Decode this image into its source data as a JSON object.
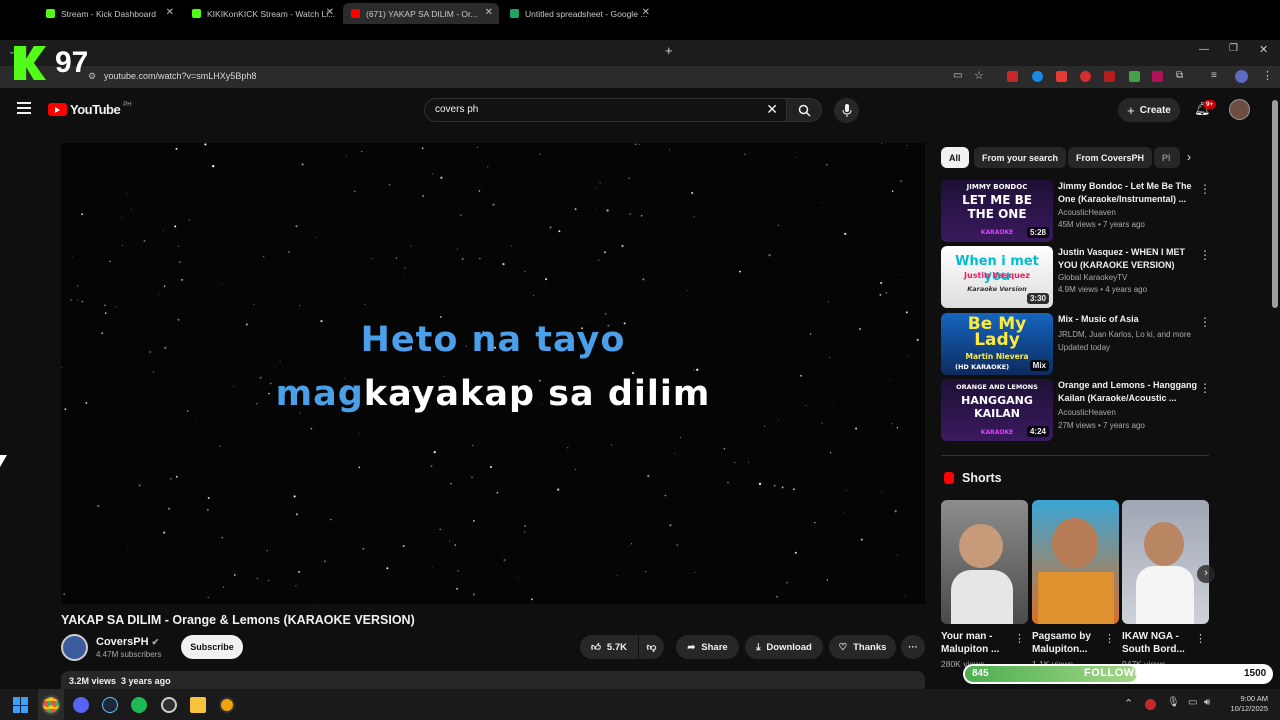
{
  "overlay": {
    "kick_counter": "97"
  },
  "browser": {
    "tabs": [
      {
        "label": "Stream - Kick Dashboard",
        "color": "#53fc18"
      },
      {
        "label": "KIKIKonKICK Stream - Watch Li...",
        "color": "#53fc18"
      },
      {
        "label": "(671) YAKAP SA DILIM - Or...",
        "color": "#ff0000"
      },
      {
        "label": "Untitled spreadsheet - Google ...",
        "color": "#1fa463"
      }
    ],
    "url": "youtube.com/watch?v=smLHXy5Bph8"
  },
  "youtube": {
    "logo_text": "YouTube",
    "region": "PH",
    "search_value": "covers ph",
    "create_label": "Create",
    "notif_count": "9+"
  },
  "video": {
    "lyric_line1": "Heto na tayo",
    "lyric_line2_sung": "mag",
    "lyric_line2_rest": "kayakap sa dilim",
    "title": "YAKAP SA DILIM - Orange & Lemons (KARAOKE VERSION)",
    "channel": "CoversPH",
    "subscribers": "4.47M subscribers",
    "subscribe_label": "Subscribe",
    "likes": "5.7K",
    "share_label": "Share",
    "download_label": "Download",
    "thanks_label": "Thanks",
    "views": "3.2M views",
    "age": "3 years ago"
  },
  "chips": [
    "All",
    "From your search",
    "From CoversPH",
    "Pl"
  ],
  "recommendations": [
    {
      "title": "Jimmy Bondoc - Let Me Be The One (Karaoke/Instrumental) ...",
      "channel": "AcousticHeaven",
      "meta": "45M views • 7 years ago",
      "duration": "5:28",
      "thumb_top": "JIMMY BONDOC",
      "thumb_main": "LET ME BE THE ONE",
      "thumb_sub": "KARAOKE"
    },
    {
      "title": "Justin Vasquez - WHEN I MET YOU (KARAOKE VERSION)",
      "channel": "Global KaraokeyTV",
      "meta": "4.9M views • 4 years ago",
      "duration": "3:30",
      "thumb_main": "When i met you",
      "thumb_sub": "Justin Vasquez",
      "thumb_tag": "Karaoke Version"
    },
    {
      "title": "Mix - Music of Asia",
      "channel": "JRLDM, Juan Karlos, Lo ki, and more",
      "meta": "Updated today",
      "duration": "Mix",
      "thumb_main": "Be My Lady",
      "thumb_sub": "Martin Nievera",
      "thumb_tag": "(HD KARAOKE)"
    },
    {
      "title": "Orange and Lemons - Hanggang Kailan (Karaoke/Acoustic ...",
      "channel": "AcousticHeaven",
      "meta": "27M views • 7 years ago",
      "duration": "4:24",
      "thumb_top": "ORANGE AND LEMONS",
      "thumb_main": "HANGGANG KAILAN",
      "thumb_sub": "KARAOKE"
    }
  ],
  "shorts": {
    "heading": "Shorts",
    "items": [
      {
        "title": "Your man - Malupiton ...",
        "views": "280K views"
      },
      {
        "title": "Pagsamo by Malupiton...",
        "views": "1.1K views"
      },
      {
        "title": "IKAW NGA - South Bord...",
        "views": "947K views"
      }
    ]
  },
  "follower_goal": {
    "current": "845",
    "label": "FOLLOWERS",
    "goal": "1500",
    "progress": 0.563
  },
  "taskbar": {
    "time": "9:00 AM",
    "date": "10/12/2025"
  }
}
